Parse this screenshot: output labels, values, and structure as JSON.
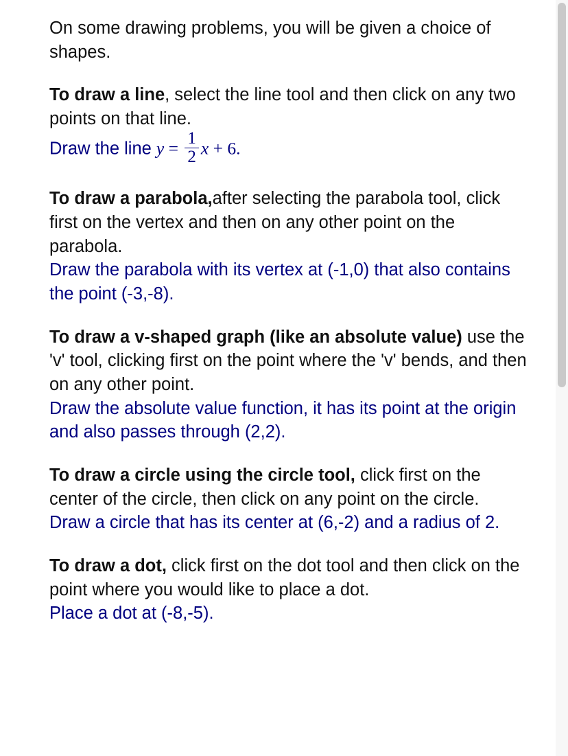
{
  "intro": "On some drawing problems, you will be given a choice of shapes.",
  "line": {
    "heading": "To draw a line",
    "body": ", select the line tool and then click on any two points on that line.",
    "task_prefix": "Draw the line ",
    "eq_y": "y",
    "eq_eq": " = ",
    "eq_num": "1",
    "eq_den": "2",
    "eq_x": "x",
    "eq_rest": " + 6.",
    "equation_plain": "y = (1/2)x + 6"
  },
  "parabola": {
    "heading": "To draw a parabola,",
    "body": "after selecting the parabola tool, click first on the vertex and then on any other point on the parabola.",
    "task": "Draw the parabola with its vertex at (-1,0) that also contains the point (-3,-8)."
  },
  "vshape": {
    "heading": "To draw a v-shaped graph (like an absolute value)",
    "body": " use the 'v' tool, clicking first on the point where the 'v' bends, and then on any other point.",
    "task": "Draw the absolute value function, it has its point at the origin and also passes through (2,2)."
  },
  "circle": {
    "heading": "To draw a circle using the circle tool,",
    "body": " click first on the center of the circle, then click on any point on the circle.",
    "task": "Draw a circle that has its center at (6,-2) and a radius of 2."
  },
  "dot": {
    "heading": "To draw a dot,",
    "body": " click first on the dot tool and then click on the point where you would like to place a dot.",
    "task": "Place a dot at (-8,-5)."
  }
}
